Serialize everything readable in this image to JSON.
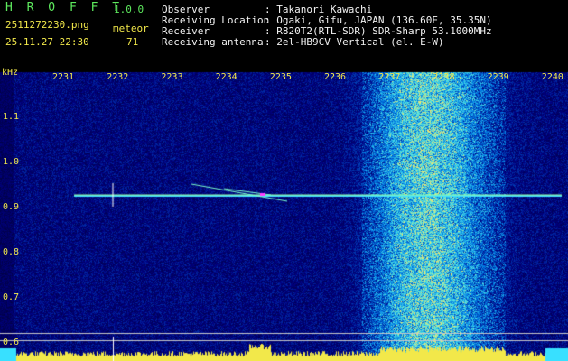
{
  "app": {
    "name": "H R O F F T",
    "version": "1.0.0"
  },
  "file": {
    "name": "2511272230.png",
    "datetime": "25.11.27 22:30"
  },
  "counter": {
    "label": "meteor",
    "value": "71"
  },
  "info": {
    "observer_label": "Observer",
    "observer_value": ": Takanori Kawachi",
    "location_label": "Receiving Location",
    "location_value": ": Ogaki, Gifu, JAPAN (136.60E, 35.35N)",
    "receiver_label": "Receiver",
    "receiver_value": ": R820T2(RTL-SDR) SDR-Sharp 53.1000MHz",
    "antenna_label": "Receiving antenna",
    "antenna_value": ": 2el-HB9CV Vertical (el. E-W)"
  },
  "axis": {
    "y_unit": "kHz",
    "x_ticks": [
      "2231",
      "2232",
      "2233",
      "2234",
      "2235",
      "2236",
      "2237",
      "2238",
      "2239",
      "2240"
    ],
    "y_ticks": [
      "1.1",
      "1.0",
      "0.9",
      "0.8",
      "0.7",
      "0.6"
    ]
  },
  "colors": {
    "header_green": "#5de85d",
    "text_white": "#f2f2f2",
    "tick_yellow": "#f2e84a",
    "background": "#000000",
    "carrier": "#40e0ff"
  }
}
